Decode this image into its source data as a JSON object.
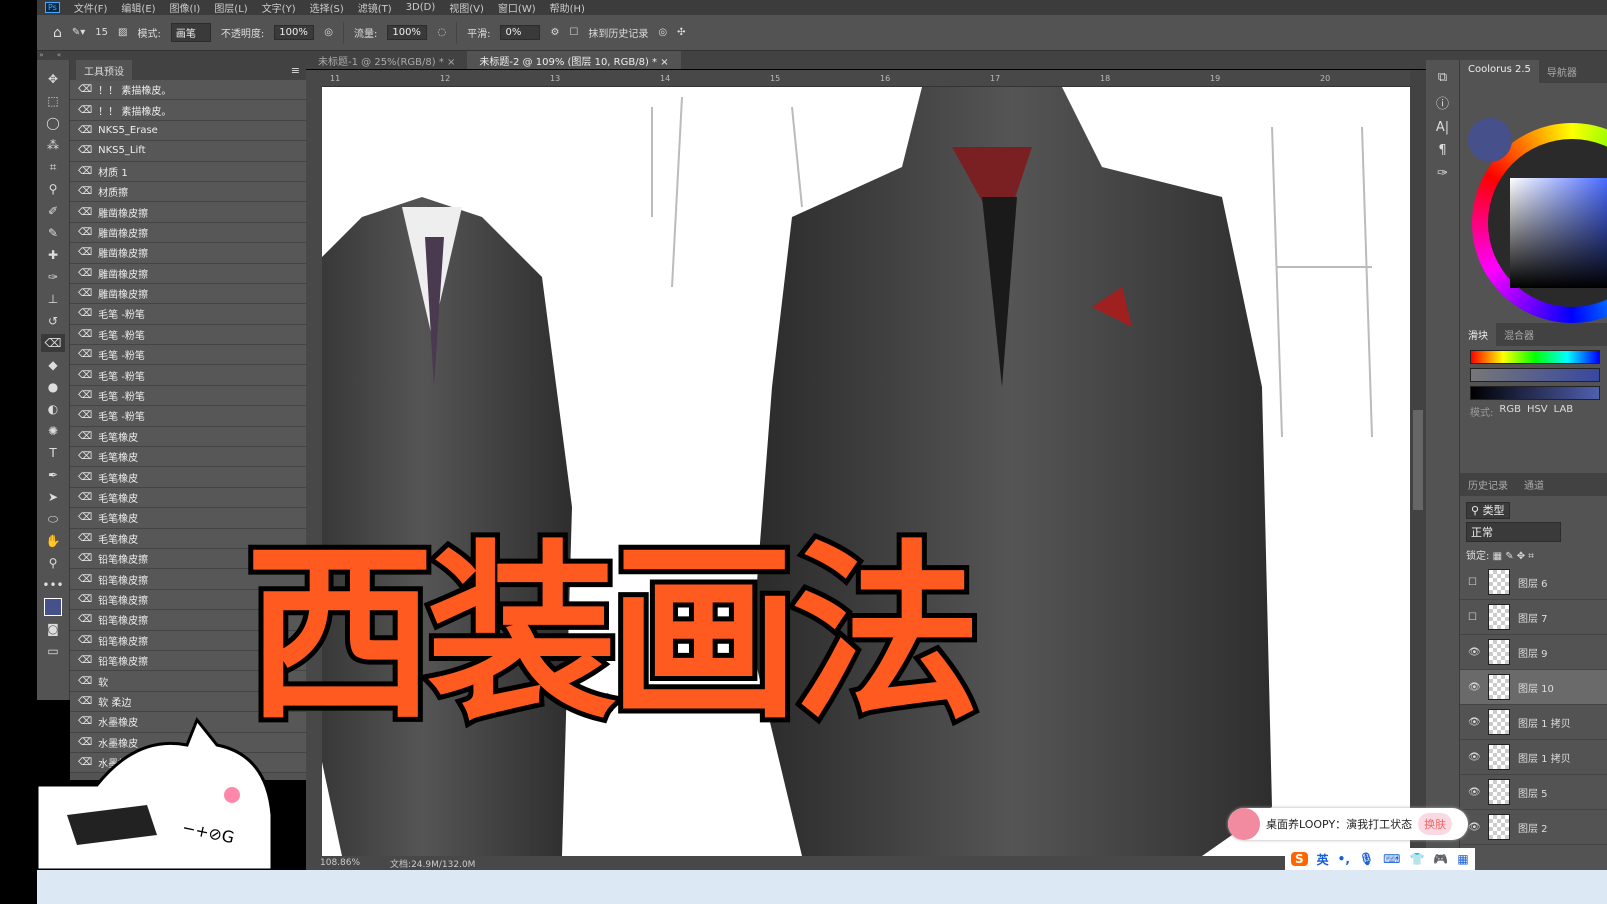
{
  "menu": [
    "文件(F)",
    "编辑(E)",
    "图像(I)",
    "图层(L)",
    "文字(Y)",
    "选择(S)",
    "滤镜(T)",
    "3D(D)",
    "视图(V)",
    "窗口(W)",
    "帮助(H)"
  ],
  "options": {
    "brush_size": "15",
    "mode_label": "模式:",
    "mode": "画笔",
    "opacity_label": "不透明度:",
    "opacity": "100%",
    "flow_label": "流量:",
    "flow": "100%",
    "smooth_label": "平滑:",
    "smooth": "0%",
    "erase_history": "抹到历史记录"
  },
  "tabs": [
    {
      "label": "未标题-1 @ 25%(RGB/8) *",
      "close": "×"
    },
    {
      "label": "未标题-2 @ 109% (图层 10, RGB/8) *",
      "close": "×"
    }
  ],
  "ruler": [
    "11",
    "12",
    "13",
    "14",
    "15",
    "16",
    "17",
    "18",
    "19",
    "20"
  ],
  "presets": {
    "title": "工具预设",
    "items": [
      "！！ 素描橡皮。",
      "！！ 素描橡皮。",
      "NKS5_Erase",
      "NKS5_Lift",
      "材质 1",
      "材质擦",
      "雕凿橡皮擦",
      "雕凿橡皮擦",
      "雕凿橡皮擦",
      "雕凿橡皮擦",
      "雕凿橡皮擦",
      "毛笔 -粉笔",
      "毛笔 -粉笔",
      "毛笔 -粉笔",
      "毛笔 -粉笔",
      "毛笔 -粉笔",
      "毛笔 -粉笔",
      "毛笔橡皮",
      "毛笔橡皮",
      "毛笔橡皮",
      "毛笔橡皮",
      "毛笔橡皮",
      "毛笔橡皮",
      "铅笔橡皮擦",
      "铅笔橡皮擦",
      "铅笔橡皮擦",
      "铅笔橡皮擦",
      "铅笔橡皮擦",
      "铅笔橡皮擦",
      "软",
      "软 柔边",
      "水墨橡皮",
      "水墨橡皮",
      "水墨橡皮"
    ]
  },
  "overlay_title": "西装画法",
  "sticker_keys": "−+⊘G",
  "status": {
    "zoom": "108.86%",
    "doc": "文档:24.9M/132.0M"
  },
  "color_panel": {
    "tabs": [
      "Coolorus 2.5",
      "导航器"
    ],
    "subtabs": [
      "滑块",
      "混合器"
    ],
    "sliders": [
      "H",
      "S",
      "V"
    ],
    "mode_label": "模式:",
    "modes": [
      "RGB",
      "HSV",
      "LAB"
    ],
    "foreground": "#46508a"
  },
  "layers_panel": {
    "tabs": [
      "历史记录",
      "通道"
    ],
    "filter": "类型",
    "blend": "正常",
    "lock_label": "锁定:",
    "layers": [
      {
        "name": "图层 6",
        "visible": false
      },
      {
        "name": "图层 7",
        "visible": false
      },
      {
        "name": "图层 9",
        "visible": true
      },
      {
        "name": "图层 10",
        "visible": true,
        "selected": true
      },
      {
        "name": "图层 1 拷贝",
        "visible": true
      },
      {
        "name": "图层 1 拷贝",
        "visible": true
      },
      {
        "name": "图层 5",
        "visible": true
      },
      {
        "name": "图层 2",
        "visible": true
      }
    ]
  },
  "notification": {
    "text": "桌面养LOOPY：演我打工状态",
    "button": "换肤"
  },
  "ime": {
    "lang": "英",
    "punct": "•,"
  },
  "colors": {
    "accent": "#ff5a1f",
    "panel": "#535353"
  }
}
